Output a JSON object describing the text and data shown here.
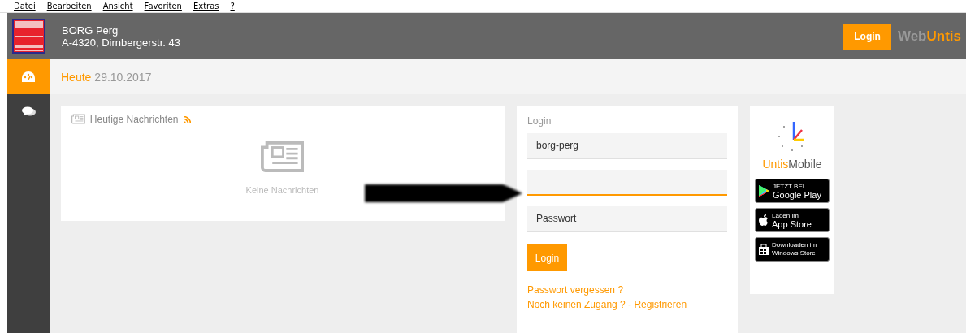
{
  "menu_bar": [
    "Datei",
    "Bearbeiten",
    "Ansicht",
    "Favoriten",
    "Extras",
    "?"
  ],
  "header": {
    "school_name": "BORG Perg",
    "address": "A-4320, Dirnbergerstr. 43",
    "login_button": "Login",
    "logo": {
      "part1": "Web",
      "part2": "Untis"
    }
  },
  "sidebar": {
    "items": [
      {
        "kind": "dashboard",
        "selected": true
      },
      {
        "kind": "messages",
        "selected": false
      }
    ]
  },
  "subheader": {
    "label": "Heute",
    "date": "29.10.2017"
  },
  "news_card": {
    "title": "Heutige Nachrichten",
    "empty_text": "Keine Nachrichten"
  },
  "login_card": {
    "title": "Login",
    "fields": [
      {
        "value": "borg-perg",
        "focused": false
      },
      {
        "focused": true
      },
      {
        "placeholder": "Passwort",
        "focused": false
      }
    ],
    "button": "Login",
    "links": [
      "Passwort vergessen ?",
      "Noch keinen Zugang ? - Registrieren"
    ]
  },
  "mobile_card": {
    "title": {
      "part1": "Untis",
      "part2": "Mobile"
    },
    "stores": [
      {
        "kind": "google",
        "small": "JETZT BEI",
        "big": "Google Play"
      },
      {
        "kind": "apple",
        "small": "Laden im",
        "big": "App Store"
      },
      {
        "kind": "windows",
        "small": "Downloaden im",
        "big": "Windows Store"
      }
    ]
  }
}
